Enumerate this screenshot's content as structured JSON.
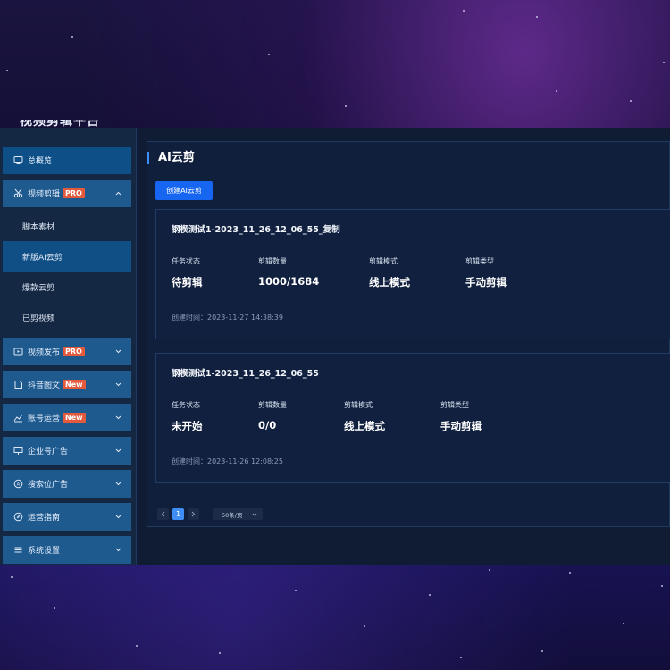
{
  "app": {
    "logo_text": "视频剪辑平台"
  },
  "sidebar": {
    "overview": {
      "label": "总概览",
      "icon": "monitor-icon"
    },
    "video_edit": {
      "label": "视频剪辑",
      "badge": "PRO",
      "icon": "scissors-icon"
    },
    "video_edit_sub": [
      {
        "label": "脚本素材"
      },
      {
        "label": "新版AI云剪"
      },
      {
        "label": "爆款云剪"
      },
      {
        "label": "已剪视频"
      }
    ],
    "items": [
      {
        "label": "视频发布",
        "badge": "PRO",
        "icon": "publish-icon"
      },
      {
        "label": "抖音图文",
        "badge": "New",
        "icon": "image-text-icon"
      },
      {
        "label": "账号运营",
        "badge": "New",
        "icon": "chart-icon"
      },
      {
        "label": "企业号广告",
        "badge": "",
        "icon": "billboard-icon"
      },
      {
        "label": "搜索位广告",
        "badge": "",
        "icon": "search-ad-icon"
      },
      {
        "label": "运营指南",
        "badge": "",
        "icon": "compass-icon"
      },
      {
        "label": "系统设置",
        "badge": "",
        "icon": "settings-list-icon"
      }
    ]
  },
  "main": {
    "title": "AI云剪",
    "create_button": "创建AI云剪",
    "tasks": [
      {
        "name": "钢楔测试1-2023_11_26_12_06_55_复制",
        "status_label": "任务状态",
        "status": "待剪辑",
        "count_label": "剪辑数量",
        "count": "1000/1684",
        "mode_label": "剪辑模式",
        "mode": "线上模式",
        "type_label": "剪辑类型",
        "type": "手动剪辑",
        "created": "创建时间：2023-11-27 14:38:39"
      },
      {
        "name": "钢楔测试1-2023_11_26_12_06_55",
        "status_label": "任务状态",
        "status": "未开始",
        "count_label": "剪辑数量",
        "count": "0/0",
        "mode_label": "剪辑模式",
        "mode": "线上模式",
        "type_label": "剪辑类型",
        "type": "手动剪辑",
        "created": "创建时间：2023-11-26 12:08:25"
      }
    ],
    "pagination": {
      "current_page": "1",
      "page_size": "50条/页"
    }
  },
  "colors": {
    "primary": "#1766f2",
    "sidebar_item": "#1e5a8e",
    "sidebar_active": "#0f4f86",
    "badge": "#e35a3d",
    "card_bg": "#10203e"
  }
}
